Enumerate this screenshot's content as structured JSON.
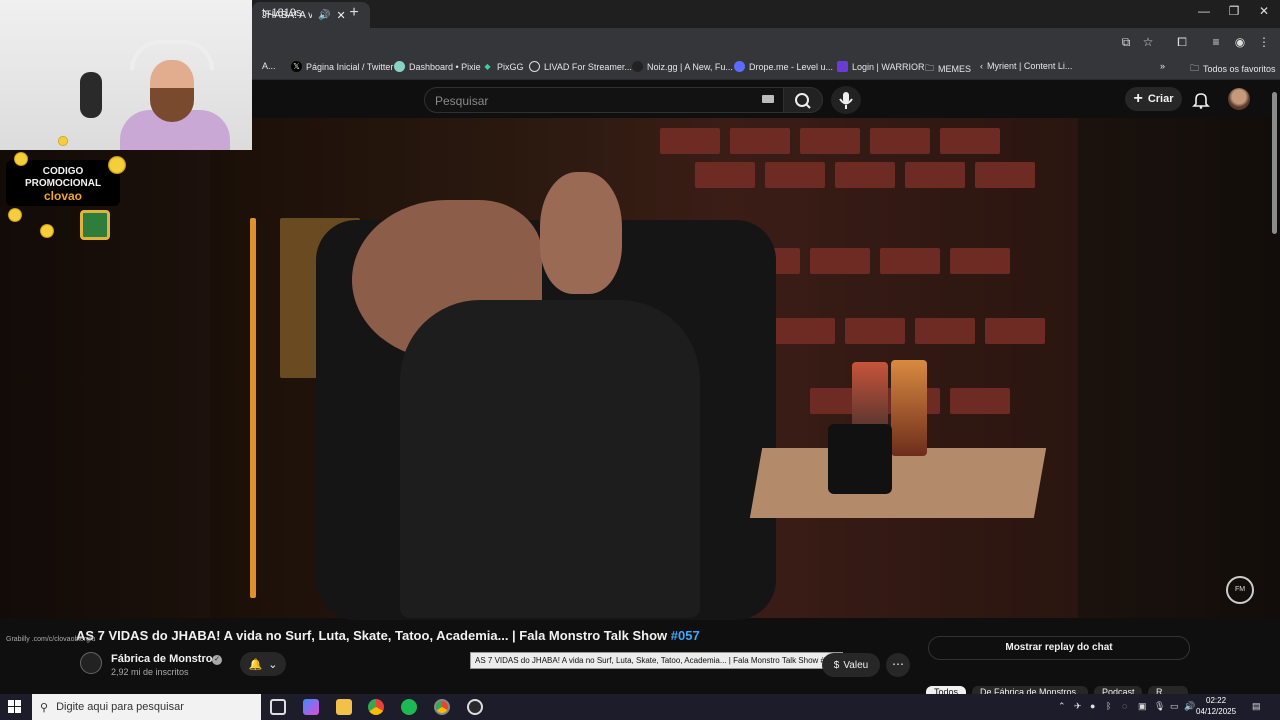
{
  "browser": {
    "tab_title": "JHABA! A vi",
    "url": "t=1819s",
    "bookmarks": [
      {
        "label": "A..."
      },
      {
        "label": "Página Inicial / Twitter"
      },
      {
        "label": "Dashboard • Pixie"
      },
      {
        "label": "PixGG"
      },
      {
        "label": "LIVAD For Streamer..."
      },
      {
        "label": "Noiz.gg | A New, Fu..."
      },
      {
        "label": "Drope.me - Level u..."
      },
      {
        "label": "Login | WARRIOR"
      },
      {
        "label": "MEMES"
      },
      {
        "label": "Myrient | Content Li..."
      }
    ],
    "all_favorites": "Todos os favoritos"
  },
  "youtube": {
    "search_placeholder": "Pesquisar",
    "create_label": "Criar",
    "video_title_main": "AS 7 VIDAS do JHABA! A vida no Surf, Luta, Skate, Tatoo, Academia... | Fala Monstro Talk Show ",
    "video_title_hash": "#057",
    "tooltip": "AS 7 VIDAS do JHABA! A vida no Surf, Luta, Skate, Tatoo, Academia... | Fala Monstro Talk Show #057",
    "channel_name": "Fábrica de Monstros",
    "subscribers": "2,92 mi de inscritos",
    "thanks_label": "Valeu",
    "replay_label": "Mostrar replay do chat",
    "chips": [
      "Todos",
      "De Fábrica de Monstros",
      "Podcast",
      "R..."
    ]
  },
  "overlay": {
    "promo_line1": "CODIGO",
    "promo_line2": "PROMOCIONAL",
    "promo_code": "clovao",
    "grab_text": "Grabilly .com/c/clovaoblerglu"
  },
  "taskbar": {
    "search_placeholder": "Digite aqui para pesquisar",
    "time": "02:22",
    "date": "04/12/2025"
  }
}
